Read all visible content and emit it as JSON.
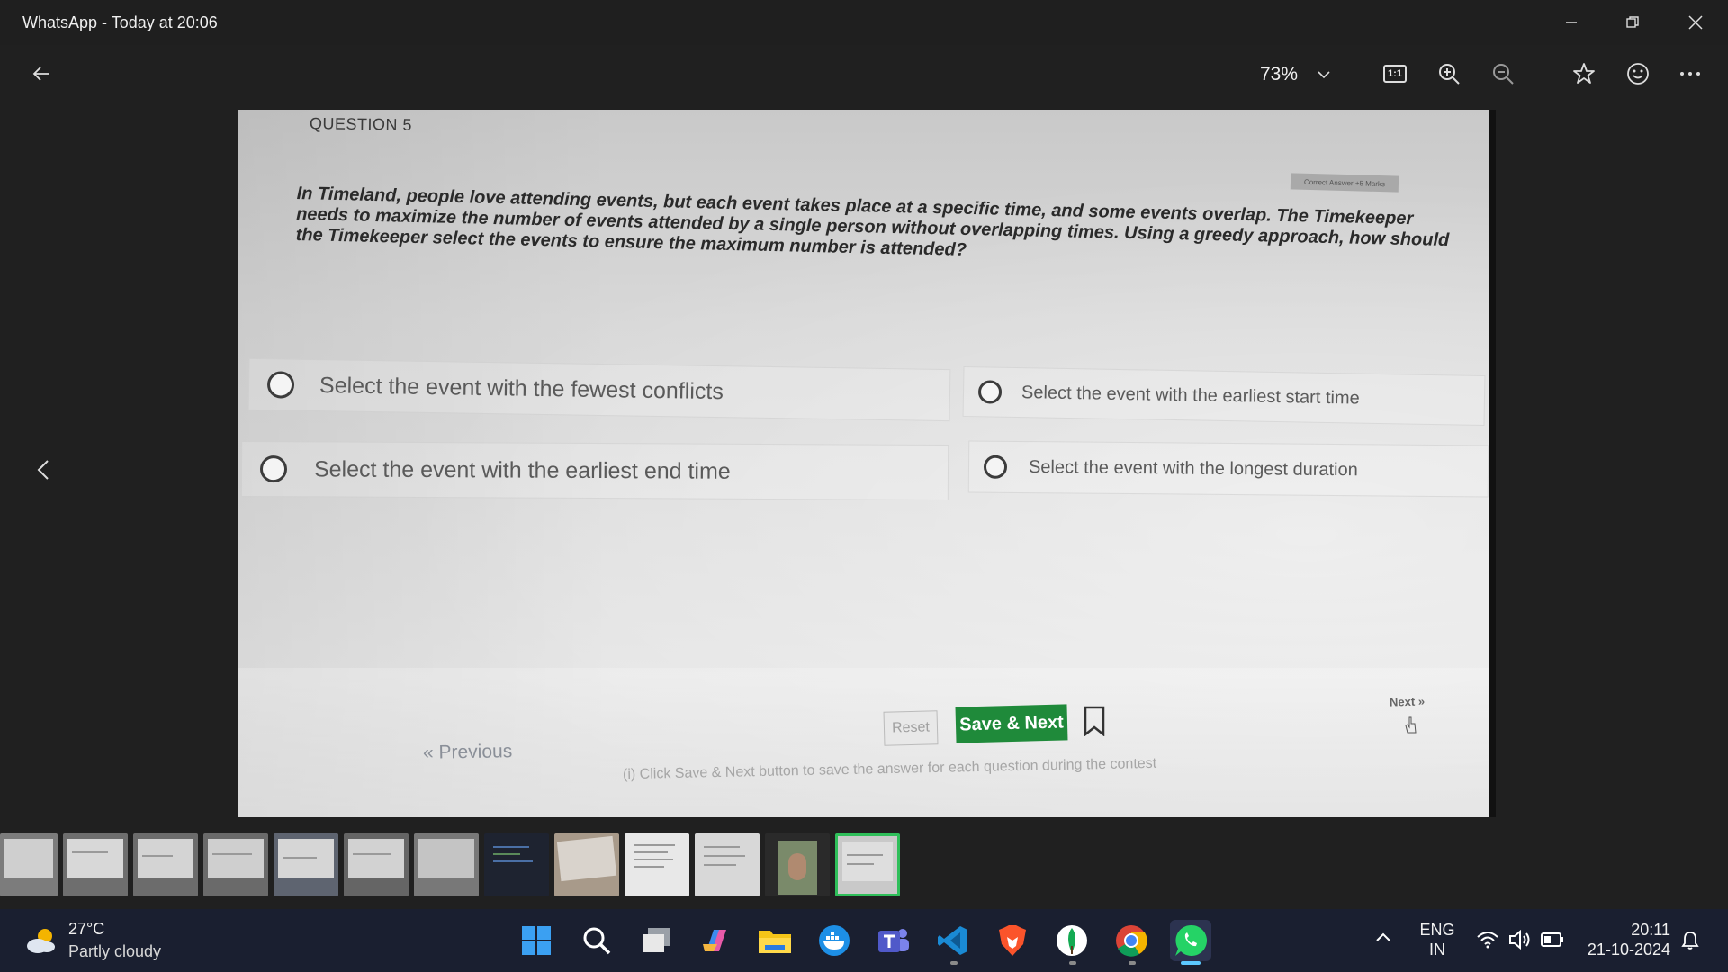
{
  "window": {
    "title": "WhatsApp - Today at 20:06"
  },
  "toolbar": {
    "zoom_label": "73%",
    "actual_size_label": "1:1"
  },
  "question": {
    "label": "QUESTION 5",
    "text": "In Timeland, people love attending events, but each event takes place at a specific time, and some events overlap. The Timekeeper needs to maximize the number of events attended by a single person without overlapping times. Using a greedy approach, how should the Timekeeper select the events to ensure the maximum number is attended?",
    "tag": "Correct Answer +5 Marks",
    "options": [
      "Select the event with the fewest conflicts",
      "Select the event with the earliest start time",
      "Select the event with the earliest end time",
      "Select the event with the longest duration"
    ],
    "previous_label": "« Previous",
    "reset_label": "Reset",
    "save_label": "Save & Next",
    "next_label": "Next »",
    "hint": "(i) Click Save & Next button to save the answer for each question during the contest"
  },
  "taskbar": {
    "weather_temp": "27°C",
    "weather_cond": "Partly cloudy",
    "lang1": "ENG",
    "lang2": "IN",
    "time": "20:11",
    "date": "21-10-2024",
    "apps": [
      "start-icon",
      "search-icon",
      "task-view-icon",
      "copilot-icon",
      "file-explorer-icon",
      "docker-icon",
      "teams-icon",
      "vscode-icon",
      "brave-icon",
      "mongodb-compass-icon",
      "chrome-icon",
      "whatsapp-icon"
    ]
  },
  "colors": {
    "accent_green": "#1f8a3a",
    "filmstrip_selected": "#2fbf5a",
    "taskbar_bg": "#1a1f30"
  }
}
